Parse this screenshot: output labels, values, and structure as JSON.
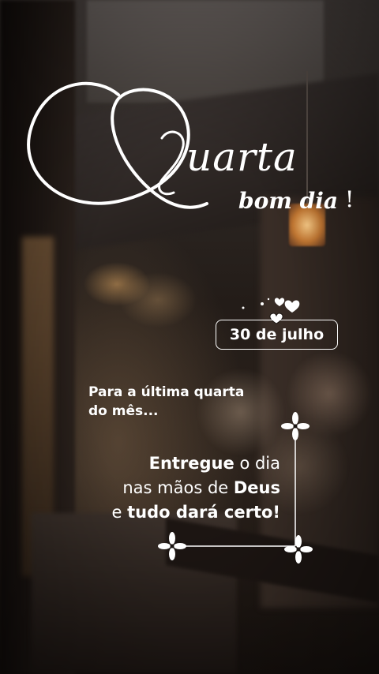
{
  "title": {
    "initial": "Q",
    "rest": "uarta"
  },
  "greeting": {
    "text": "bom dia",
    "exclamation": "!"
  },
  "date": "30 de julho",
  "intro": {
    "line1": "Para a última quarta",
    "line2": "do mês..."
  },
  "message": {
    "l1_bold": "Entregue",
    "l1_rest": " o dia",
    "l2_rest": "nas mãos de ",
    "l2_bold": "Deus",
    "l3_rest": "e ",
    "l3_bold": "tudo dará certo!"
  },
  "icons": [
    "hearts-icon",
    "heart-pin-icon",
    "flower-ornament-icon"
  ],
  "colors": {
    "text": "#ffffff",
    "lantern": "#ffc27a"
  }
}
